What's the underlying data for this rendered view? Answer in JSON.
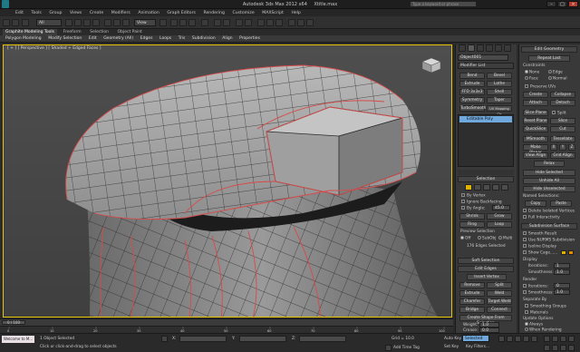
{
  "window": {
    "title": "Autodesk 3ds Max 2012 x64",
    "file": "Xtitle.max",
    "search_placeholder": "Type a keyword or phrase"
  },
  "menu": [
    "Edit",
    "Tools",
    "Group",
    "Views",
    "Create",
    "Modifiers",
    "Animation",
    "Graph Editors",
    "Rendering",
    "Customize",
    "MAXScript",
    "Help"
  ],
  "toolbar": {
    "selection_filter": "All",
    "view": "View",
    "undo_label": "C..."
  },
  "ribbon": {
    "tabs": [
      "Graphite Modeling Tools",
      "Freeform",
      "Selection",
      "Object Paint"
    ],
    "items": [
      "Polygon Modeling",
      "Modify Selection",
      "Edit",
      "Geometry (All)",
      "Edges",
      "Loops",
      "Tris",
      "Subdivision",
      "Align",
      "Properties"
    ]
  },
  "viewport": {
    "label": "[ + ] [ Perspective ] [ Shaded + Edged Faces ]"
  },
  "modify": {
    "object_name": "Object001",
    "modifier_list": "Modifier List",
    "buttons": [
      "Bend",
      "Bevel",
      "Extrude",
      "Lathe",
      "FFD 3x3x3",
      "Shell",
      "Symmetry",
      "Taper",
      "TurboSmooth",
      "UV Mapping Clr"
    ],
    "stack_item": "Editable Poly",
    "selection_header": "Selection",
    "by_vertex": "By Vertex",
    "ignore_backfacing": "Ignore Backfacing",
    "by_angle": "By Angle:",
    "angle_value": "45.0",
    "shrink": "Shrink",
    "grow": "Grow",
    "ring": "Ring",
    "loop": "Loop",
    "preview_selection": "Preview Selection",
    "preview_opts": [
      "Off",
      "SubObj",
      "Multi"
    ],
    "edges_selected": "176 Edges Selected",
    "soft_selection": "Soft Selection",
    "edit_edges": "Edit Edges",
    "insert_vertex": "Insert Vertex",
    "edge_btns": [
      "Remove",
      "Split",
      "Extrude",
      "Weld",
      "Chamfer",
      "Target Weld",
      "Bridge",
      "Connect"
    ],
    "create_shape": "Create Shape From Selection",
    "weight_label": "Weight:",
    "weight_value": "1.0",
    "crease_label": "Crease:",
    "crease_value": "0.0"
  },
  "edit_geometry": {
    "header": "Edit Geometry",
    "repeat_last": "Repeat Last",
    "constraints": "Constraints",
    "constraint_opts": [
      "None",
      "Edge",
      "Face",
      "Normal"
    ],
    "preserve_uvs": "Preserve UVs",
    "buttons": [
      "Create",
      "Collapse",
      "Attach",
      "Detach",
      "Slice Plane",
      "Split",
      "Reset Plane",
      "Slice",
      "QuickSlice",
      "Cut",
      "MSmooth",
      "Tessellate",
      "Make Planar",
      "X",
      "Y",
      "Z",
      "View Align",
      "Grid Align",
      "Relax"
    ],
    "hide_selected": "Hide Selected",
    "unhide_all": "Unhide All",
    "hide_unselected": "Hide Unselected",
    "named_selections": "Named Selections:",
    "copy": "Copy",
    "paste": "Paste",
    "delete_isolated": "Delete Isolated Vertices",
    "full_interactivity": "Full Interactivity"
  },
  "subdivision": {
    "header": "Subdivision Surface",
    "smooth_result": "Smooth Result",
    "use_nurms": "Use NURMS Subdivision",
    "isoline": "Isoline Display",
    "show_cage": "Show Cage......",
    "display": "Display",
    "iterations_label": "Iterations:",
    "iterations_value": "1",
    "smoothness_label": "Smoothness:",
    "smoothness_value": "1.0",
    "render": "Render",
    "r_iterations_value": "0",
    "r_smoothness_value": "1.0",
    "separate_by": "Separate By",
    "smoothing_groups": "Smoothing Groups",
    "materials": "Materials",
    "update_options": "Update Options",
    "always": "Always",
    "when_rendering": "When Rendering",
    "manually": "Manually"
  },
  "timeline": {
    "frame": "0 / 100",
    "ticks": [
      "0",
      "10",
      "20",
      "30",
      "40",
      "50",
      "60",
      "70",
      "80",
      "90",
      "100"
    ]
  },
  "status": {
    "selected": "1 Object Selected",
    "prompt": "Click or click-and-drag to select objects",
    "welcome": "Welcome to M...",
    "x_label": "X:",
    "y_label": "Y:",
    "z_label": "Z:",
    "grid": "Grid = 10.0",
    "auto_key": "Auto Key",
    "selected_dd": "Selected",
    "set_key": "Set Key",
    "key_filters": "Key Filters...",
    "add_time_tag": "Add Time Tag"
  },
  "colors": {
    "accent": "#e0b200",
    "edge_sel": "#d84a4a",
    "mesh": "#a9a9a9",
    "panel": "#393939"
  }
}
